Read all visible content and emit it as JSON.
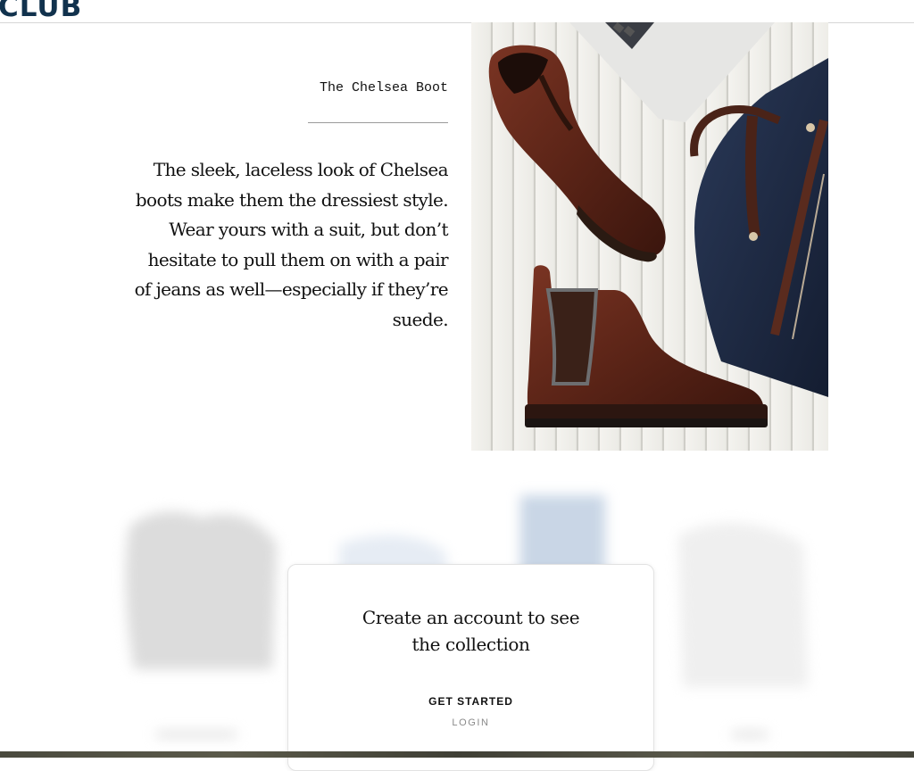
{
  "header": {
    "logo_text": "CLUB"
  },
  "feature": {
    "eyebrow": "The Chelsea Boot",
    "description": "The sleek, laceless look of Chelsea boots make them the dressiest style. Wear yours with a suit, but don’t hesitate to pull them on with a pair of jeans as well—especially if they’re suede."
  },
  "cta": {
    "title": "Create an account to see the collection",
    "primary_label": "GET STARTED",
    "secondary_label": "LOGIN"
  },
  "colors": {
    "logo": "#11324d",
    "boot_leather": "#5b2417",
    "bag_navy": "#1f2b45"
  }
}
